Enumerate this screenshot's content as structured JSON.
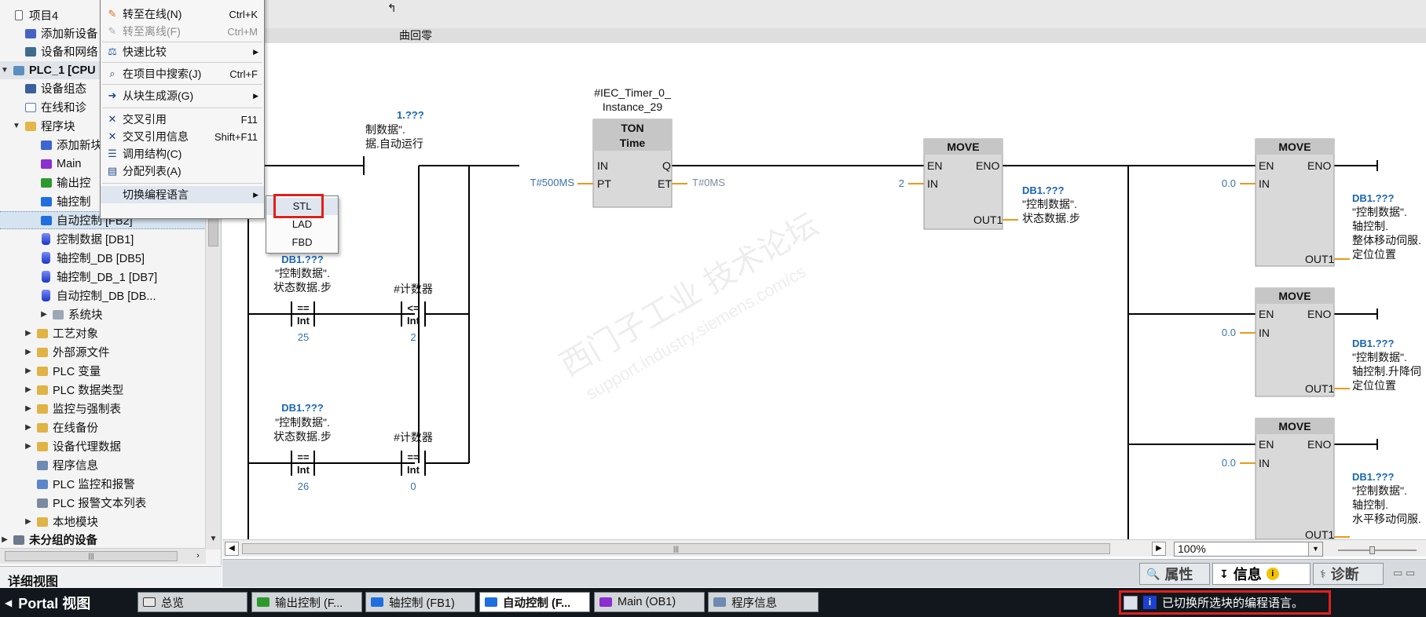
{
  "tree": {
    "items": [
      {
        "label": "项目4",
        "icon": "project-icon"
      },
      {
        "label": "添加新设备",
        "icon": "add-device-icon"
      },
      {
        "label": "设备和网络",
        "icon": "network-icon"
      },
      {
        "label": "PLC_1 [CPU",
        "icon": "plc-icon"
      },
      {
        "label": "设备组态",
        "icon": "device-config-icon"
      },
      {
        "label": "在线和诊",
        "icon": "online-diag-icon"
      },
      {
        "label": "程序块",
        "icon": "folder-icon"
      },
      {
        "label": "添加新块",
        "icon": "add-block-icon"
      },
      {
        "label": "Main",
        "icon": "ob-icon"
      },
      {
        "label": "输出控",
        "icon": "fc-icon"
      },
      {
        "label": "轴控制",
        "icon": "fb-icon"
      },
      {
        "label": "自动控制 [FB2]",
        "icon": "fb-icon"
      },
      {
        "label": "控制数据 [DB1]",
        "icon": "db-icon"
      },
      {
        "label": "轴控制_DB [DB5]",
        "icon": "db-icon"
      },
      {
        "label": "轴控制_DB_1 [DB7]",
        "icon": "db-icon"
      },
      {
        "label": "自动控制_DB [DB...",
        "icon": "db-icon"
      },
      {
        "label": "系统块",
        "icon": "system-block-icon"
      },
      {
        "label": "工艺对象",
        "icon": "tech-object-icon"
      },
      {
        "label": "外部源文件",
        "icon": "ext-source-icon"
      },
      {
        "label": "PLC 变量",
        "icon": "plc-tags-icon"
      },
      {
        "label": "PLC 数据类型",
        "icon": "plc-datatypes-icon"
      },
      {
        "label": "监控与强制表",
        "icon": "watch-table-icon"
      },
      {
        "label": "在线备份",
        "icon": "backup-icon"
      },
      {
        "label": "设备代理数据",
        "icon": "proxy-data-icon"
      },
      {
        "label": "程序信息",
        "icon": "program-info-icon"
      },
      {
        "label": "PLC 监控和报警",
        "icon": "alarm-icon"
      },
      {
        "label": "PLC 报警文本列表",
        "icon": "alarm-text-icon"
      },
      {
        "label": "本地模块",
        "icon": "local-module-icon"
      },
      {
        "label": "未分组的设备",
        "icon": "ungrouped-icon"
      }
    ]
  },
  "detail_view": {
    "label": "详细视图"
  },
  "context_menu": {
    "items": [
      {
        "label": "转至在线(N)",
        "shortcut": "Ctrl+K"
      },
      {
        "label": "转至离线(F)",
        "shortcut": "Ctrl+M"
      },
      {
        "label": "快速比较",
        "shortcut": ""
      },
      {
        "label": "在项目中搜索(J)",
        "shortcut": "Ctrl+F"
      },
      {
        "label": "从块生成源(G)",
        "shortcut": ""
      },
      {
        "label": "交叉引用",
        "shortcut": "F11"
      },
      {
        "label": "交叉引用信息",
        "shortcut": "Shift+F11"
      },
      {
        "label": "调用结构(C)",
        "shortcut": ""
      },
      {
        "label": "分配列表(A)",
        "shortcut": ""
      },
      {
        "label": "切换编程语言",
        "shortcut": ""
      }
    ],
    "submenu": [
      "STL",
      "LAD",
      "FBD"
    ]
  },
  "editor": {
    "block_title_fragment": "曲回零",
    "network": {
      "contact_top": {
        "operand": "1.???",
        "name": "制数据\".",
        "member": "据.自动运行"
      },
      "timer": {
        "instance_line1": "#IEC_Timer_0_",
        "instance_line2": "Instance_29",
        "type": "TON",
        "subtype": "Time",
        "in": "IN",
        "q": "Q",
        "pt": "PT",
        "et": "ET",
        "pt_value": "T#500MS",
        "et_value": "T#0MS"
      },
      "move1": {
        "title": "MOVE",
        "en": "EN",
        "eno": "ENO",
        "in": "IN",
        "out": "OUT1",
        "in_value": "2",
        "out_db": "DB1.???",
        "out_line1": "\"控制数据\".",
        "out_line2": "状态数据.步"
      },
      "move2": {
        "title": "MOVE",
        "en": "EN",
        "eno": "ENO",
        "in": "IN",
        "out": "OUT1",
        "in_value": "0.0",
        "out_db": "DB1.???",
        "out_line1": "\"控制数据\".",
        "out_line2": "轴控制.",
        "out_line3": "整体移动伺服.",
        "out_line4": "定位位置"
      },
      "move3": {
        "title": "MOVE",
        "en": "EN",
        "eno": "ENO",
        "in": "IN",
        "out": "OUT1",
        "in_value": "0.0",
        "out_db": "DB1.???",
        "out_line1": "\"控制数据\".",
        "out_line2": "轴控制.升降伺",
        "out_line3": "定位位置"
      },
      "move4": {
        "title": "MOVE",
        "en": "EN",
        "eno": "ENO",
        "in": "IN",
        "out": "OUT1",
        "in_value": "0.0",
        "out_db": "DB1.???",
        "out_line1": "\"控制数据\".",
        "out_line2": "轴控制.",
        "out_line3": "水平移动伺服.",
        "out_line4": "OUT1"
      },
      "cmp1": {
        "db": "DB1.???",
        "line1": "\"控制数据\".",
        "line2": "状态数据.步",
        "op": "==",
        "type": "Int",
        "value": "25"
      },
      "cmp2": {
        "operand": "#计数器",
        "op": "<=",
        "type": "Int",
        "value": "2"
      },
      "cmp3": {
        "db": "DB1.???",
        "line1": "\"控制数据\".",
        "line2": "状态数据.步",
        "op": "==",
        "type": "Int",
        "value": "26"
      },
      "cmp4": {
        "operand": "#计数器",
        "op": "==",
        "type": "Int",
        "value": "0"
      }
    },
    "watermark_line1": "西门子工业 技术论坛",
    "watermark_line2": "support.industry.siemens.com/cs",
    "zoom": "100%"
  },
  "inspector": {
    "tabs": [
      "属性",
      "信息",
      "诊断"
    ]
  },
  "taskbar": {
    "portal_label": "Portal 视图",
    "tasks": [
      "总览",
      "输出控制 (F...",
      "轴控制 (FB1)",
      "自动控制 (F...",
      "Main (OB1)",
      "程序信息"
    ],
    "status_message": "已切换所选块的编程语言。",
    "info_glyph": "i"
  },
  "colors": {
    "accent_red": "#e0201c",
    "operand_blue": "#1a66b2",
    "taskbar_bg": "#11171c",
    "selection": "#d6e4f0"
  }
}
